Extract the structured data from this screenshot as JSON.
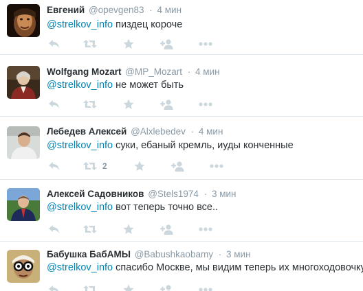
{
  "tweets": [
    {
      "name": "Евгений",
      "handle": "@opevgen83",
      "separator": "·",
      "time": "4 мин",
      "mention": "@strelkov_info",
      "text": " пиздец короче",
      "retweet_count": ""
    },
    {
      "name": "Wolfgang Mozart",
      "handle": "@MP_Mozart",
      "separator": "·",
      "time": "4 мин",
      "mention": "@strelkov_info",
      "text": " не может быть",
      "retweet_count": ""
    },
    {
      "name": "Лебедев Алексей",
      "handle": "@Alxlebedev",
      "separator": "·",
      "time": "4 мин",
      "mention": "@strelkov_info",
      "text": " суки, ебаный кремль, иуды конченные",
      "retweet_count": "2"
    },
    {
      "name": "Алексей Садовников",
      "handle": "@Stels1974",
      "separator": "·",
      "time": "3 мин",
      "mention": "@strelkov_info",
      "text": " вот теперь точно все..",
      "retweet_count": ""
    },
    {
      "name": "Бабушка БабАМЫ",
      "handle": "@Babushkaobamy",
      "separator": "·",
      "time": "3 мин",
      "mention": "@strelkov_info",
      "text": " спасибо Москве, мы видим теперь их многоходовочку",
      "retweet_count": ""
    }
  ],
  "icons": {
    "reply": "reply-icon",
    "retweet": "retweet-icon",
    "favorite": "star-icon",
    "follow": "follow-icon",
    "more": "more-icon"
  },
  "colors": {
    "mention": "#0084b4",
    "meta": "#8899a6",
    "icon": "#ccd6dd",
    "divider": "#e1e8ed"
  }
}
